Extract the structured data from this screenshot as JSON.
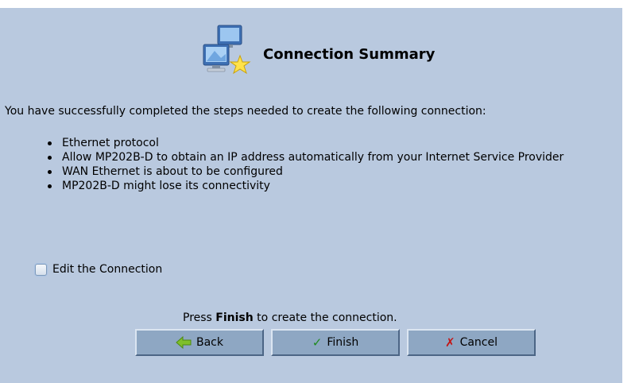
{
  "header": {
    "title": "Connection Summary",
    "icon": "network-computers-star-icon"
  },
  "summary": {
    "intro": "You have successfully completed the steps needed to create the following connection:",
    "items": [
      "Ethernet protocol",
      "Allow MP202B-D to obtain an IP address automatically from your Internet Service Provider",
      "WAN Ethernet is about to be configured",
      "MP202B-D might lose its connectivity"
    ]
  },
  "edit_option": {
    "label": "Edit the Connection",
    "checked": false
  },
  "instruction": {
    "prefix": "Press ",
    "action": "Finish",
    "suffix": " to create the connection."
  },
  "buttons": {
    "back": {
      "label": "Back",
      "icon": "back-arrow-icon"
    },
    "finish": {
      "label": "Finish",
      "icon": "checkmark-icon"
    },
    "cancel": {
      "label": "Cancel",
      "icon": "x-mark-icon"
    }
  },
  "colors": {
    "panel_background": "#b9c9df",
    "button_face": "#8ea7c3",
    "finish_icon": "#1f8a1f",
    "cancel_icon": "#c41414",
    "back_icon": "#7fbf2a"
  }
}
